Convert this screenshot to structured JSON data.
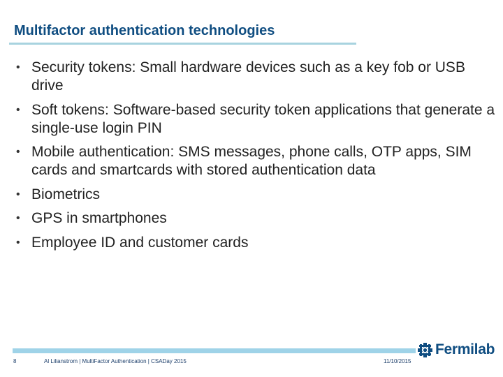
{
  "slide": {
    "title": "Multifactor authentication technologies",
    "bullets": [
      {
        "text": "Security tokens: Small hardware devices such as a key fob or USB drive"
      },
      {
        "text": "Soft tokens: Software-based security token applications that generate a single-use login PIN"
      },
      {
        "text": "Mobile authentication: SMS messages, phone calls, OTP apps, SIM cards and smartcards with stored authentication data"
      },
      {
        "text": "Biometrics"
      },
      {
        "text": "GPS in smartphones"
      },
      {
        "text": "Employee ID and customer cards"
      }
    ],
    "bullet_glyph": "•"
  },
  "footer": {
    "page_number": "8",
    "text": "Al Lilianstrom | MultiFactor Authentication | CSADay 2015",
    "date": "11/10/2015",
    "logo_text": "Fermilab",
    "logo_icon": "fermilab-logo-icon"
  },
  "colors": {
    "title": "#0f4d81",
    "accent_rule": "#a8d3df",
    "footer_rule": "#9fd3e8",
    "body_text": "#222222"
  }
}
